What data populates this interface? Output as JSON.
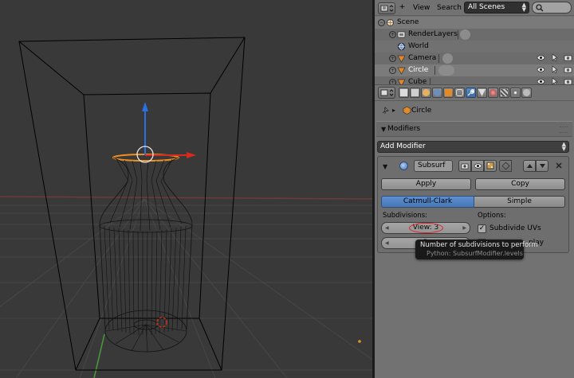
{
  "outliner": {
    "menu_view": "View",
    "menu_search": "Search",
    "scenes_select": "All Scenes",
    "rows": [
      {
        "label": "Scene"
      },
      {
        "label": "RenderLayers"
      },
      {
        "label": "World"
      },
      {
        "label": "Camera"
      },
      {
        "label": "Circle"
      },
      {
        "label": "Cube"
      }
    ]
  },
  "properties": {
    "breadcrumb_object": "Circle",
    "panel_title": "Modifiers",
    "add_modifier_label": "Add Modifier",
    "modifier": {
      "name": "Subsurf",
      "apply_label": "Apply",
      "copy_label": "Copy",
      "catmull_label": "Catmull-Clark",
      "simple_label": "Simple",
      "subdivisions_label": "Subdivisions:",
      "options_label": "Options:",
      "view_value": "View: 3",
      "render_value": "R",
      "subdivide_uvs_label": "Subdivide UVs",
      "subdivide_uvs_checked": "✓",
      "optimal_label": "play",
      "optimal_checked": ""
    }
  },
  "tooltip": {
    "text": "Number of subdivisions to perform",
    "python": "Python: SubsurfModifier.levels"
  },
  "colors": {
    "accent_blue": "#5a89c5",
    "highlight_red": "#e0202a",
    "axis_x": "#d62a1e",
    "axis_y": "#2b6fe0",
    "axis_z_grid": "#5aa83c",
    "selected_orange": "#f09020"
  }
}
